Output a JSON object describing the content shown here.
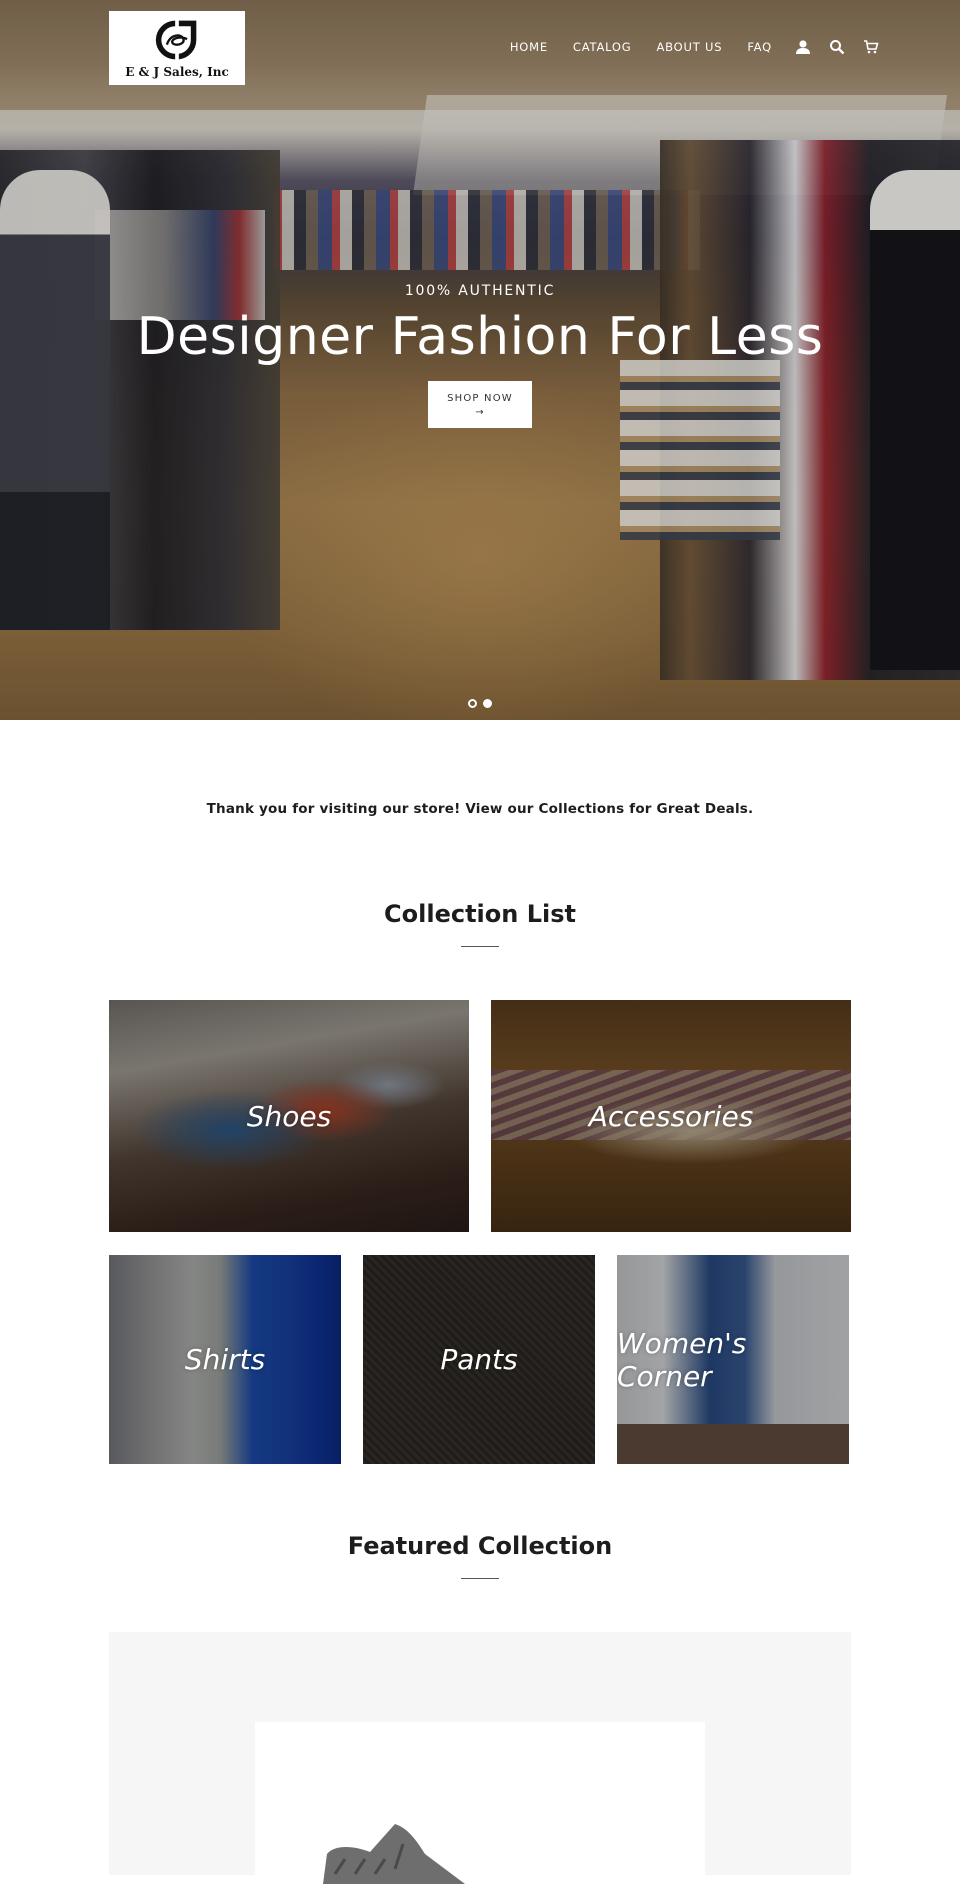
{
  "header": {
    "logo_text": "E & J Sales, Inc",
    "nav": [
      "HOME",
      "CATALOG",
      "ABOUT US",
      "FAQ"
    ],
    "icons": [
      "account-icon",
      "search-icon",
      "cart-icon"
    ]
  },
  "hero": {
    "subtitle": "100% AUTHENTIC",
    "title": "Designer Fashion For Less",
    "button_label": "SHOP NOW",
    "button_arrow": "→",
    "slides": 2,
    "active_slide": 2
  },
  "intro_text": "Thank you for visiting our store! View our Collections for Great Deals.",
  "collection_list": {
    "title": "Collection List",
    "items": [
      {
        "label": "Shoes"
      },
      {
        "label": "Accessories"
      },
      {
        "label": "Shirts"
      },
      {
        "label": "Pants"
      },
      {
        "label": "Women's Corner"
      }
    ]
  },
  "featured_collection": {
    "title": "Featured Collection"
  }
}
